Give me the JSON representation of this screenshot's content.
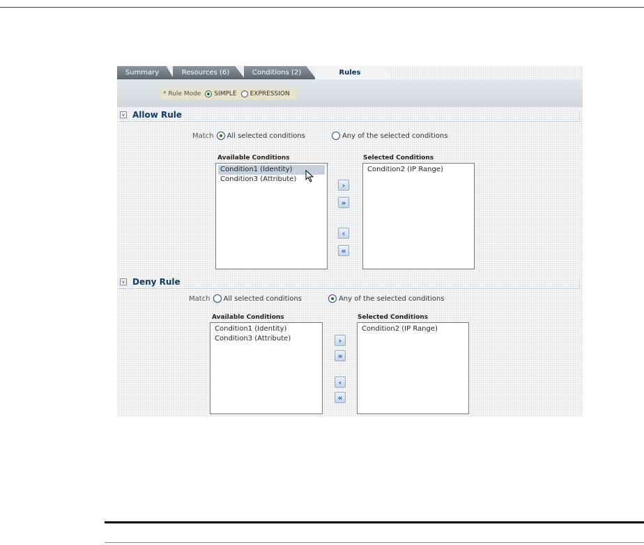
{
  "tabs": [
    "Summary",
    "Resources (6)",
    "Conditions (2)",
    "Rules"
  ],
  "rule_mode": {
    "label": "* Rule Mode",
    "options": [
      "SIMPLE",
      "EXPRESSION"
    ],
    "selected": "SIMPLE"
  },
  "allow_rule": {
    "title": "Allow Rule",
    "match_label": "Match",
    "match_options": [
      "All selected conditions",
      "Any of the selected conditions"
    ],
    "match_selected": "All selected conditions",
    "available_label": "Available Conditions",
    "available": [
      "Condition1 (Identity)",
      "Condition3 (Attribute)"
    ],
    "selected_label": "Selected Conditions",
    "selected": [
      "Condition2 (IP Range)"
    ]
  },
  "deny_rule": {
    "title": "Deny Rule",
    "match_label": "Match",
    "match_options": [
      "All selected conditions",
      "Any of the selected conditions"
    ],
    "match_selected": "Any of the selected conditions",
    "available_label": "Available Conditions",
    "available": [
      "Condition1 (Identity)",
      "Condition3 (Attribute)"
    ],
    "selected_label": "Selected Conditions",
    "selected": [
      "Condition2 (IP Range)"
    ]
  },
  "shuttle_buttons": {
    "move": "›",
    "move_all": "»",
    "remove": "‹",
    "remove_all": "«"
  },
  "icons": {
    "disclosure": "chevron-down-icon",
    "cursor": "mouse-pointer-icon"
  }
}
